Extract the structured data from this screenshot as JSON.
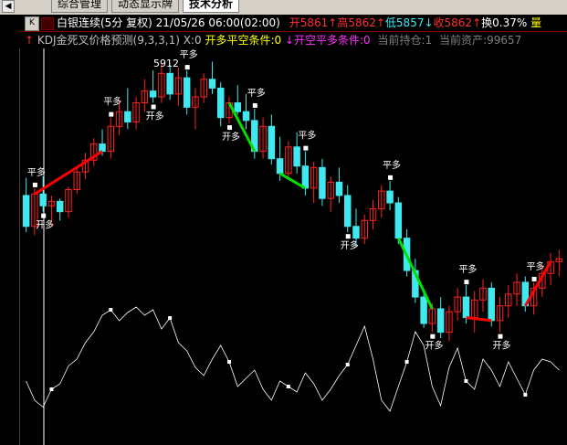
{
  "tabs": [
    {
      "label": "综合管理",
      "active": false
    },
    {
      "label": "动态显示牌",
      "active": false
    },
    {
      "label": "技术分析",
      "active": true
    }
  ],
  "header": {
    "k_button": "K",
    "title": "白银连续(5分 复权) 21/05/26 06:00(02:00)",
    "open": "开5861",
    "high": "高5862",
    "low": "低5857",
    "close": "收5862",
    "turnover": "换0.37%",
    "extra": "量"
  },
  "formula": {
    "name": "KDJ金死叉价格预测(9,3,3,1) X:0",
    "buy_cond": "开多平空条件:0",
    "sell_cond": "开空平多条件:0",
    "position": "当前持仓:1",
    "assets": "当前资产:99657"
  },
  "annotations": {
    "price_label": "5912",
    "buy_tag": "开多",
    "sell_tag": "平多"
  },
  "colors": {
    "up": "#ff2020",
    "down": "#40e8f0",
    "buy_signal": "#00e000",
    "sell_signal": "#ff0000",
    "kdj_line": "#ffffff",
    "bg": "#000000"
  },
  "candles": [
    [
      5905,
      5917,
      5880,
      5884
    ],
    [
      5884,
      5910,
      5878,
      5906
    ],
    [
      5906,
      5918,
      5894,
      5898
    ],
    [
      5898,
      5905,
      5884,
      5901
    ],
    [
      5901,
      5903,
      5888,
      5894
    ],
    [
      5894,
      5911,
      5890,
      5909
    ],
    [
      5909,
      5925,
      5906,
      5921
    ],
    [
      5921,
      5934,
      5916,
      5929
    ],
    [
      5929,
      5944,
      5925,
      5940
    ],
    [
      5940,
      5950,
      5932,
      5935
    ],
    [
      5935,
      5958,
      5930,
      5952
    ],
    [
      5952,
      5970,
      5946,
      5962
    ],
    [
      5962,
      5978,
      5950,
      5955
    ],
    [
      5955,
      5972,
      5950,
      5968
    ],
    [
      5968,
      5984,
      5962,
      5976
    ],
    [
      5976,
      5990,
      5968,
      5972
    ],
    [
      5972,
      5995,
      5968,
      5988
    ],
    [
      5988,
      5994,
      5970,
      5974
    ],
    [
      5974,
      5992,
      5966,
      5985
    ],
    [
      5985,
      5990,
      5960,
      5965
    ],
    [
      5965,
      5978,
      5950,
      5972
    ],
    [
      5972,
      5988,
      5968,
      5984
    ],
    [
      5984,
      5996,
      5974,
      5978
    ],
    [
      5978,
      5982,
      5952,
      5958
    ],
    [
      5958,
      5972,
      5954,
      5968
    ],
    [
      5968,
      5980,
      5960,
      5962
    ],
    [
      5962,
      5974,
      5950,
      5956
    ],
    [
      5956,
      5964,
      5930,
      5935
    ],
    [
      5935,
      5958,
      5930,
      5952
    ],
    [
      5952,
      5960,
      5926,
      5930
    ],
    [
      5930,
      5945,
      5915,
      5920
    ],
    [
      5920,
      5942,
      5916,
      5938
    ],
    [
      5938,
      5948,
      5920,
      5925
    ],
    [
      5925,
      5935,
      5905,
      5910
    ],
    [
      5910,
      5928,
      5900,
      5924
    ],
    [
      5924,
      5930,
      5898,
      5903
    ],
    [
      5903,
      5918,
      5894,
      5914
    ],
    [
      5914,
      5924,
      5900,
      5905
    ],
    [
      5905,
      5912,
      5880,
      5884
    ],
    [
      5884,
      5896,
      5870,
      5876
    ],
    [
      5876,
      5892,
      5872,
      5888
    ],
    [
      5888,
      5902,
      5882,
      5896
    ],
    [
      5896,
      5912,
      5890,
      5908
    ],
    [
      5908,
      5915,
      5895,
      5900
    ],
    [
      5900,
      5904,
      5872,
      5876
    ],
    [
      5876,
      5882,
      5850,
      5854
    ],
    [
      5854,
      5862,
      5832,
      5836
    ],
    [
      5836,
      5840,
      5815,
      5818
    ],
    [
      5818,
      5832,
      5812,
      5828
    ],
    [
      5828,
      5836,
      5808,
      5812
    ],
    [
      5812,
      5830,
      5806,
      5826
    ],
    [
      5826,
      5842,
      5820,
      5836
    ],
    [
      5836,
      5844,
      5818,
      5822
    ],
    [
      5822,
      5840,
      5812,
      5834
    ],
    [
      5834,
      5848,
      5826,
      5842
    ],
    [
      5842,
      5846,
      5816,
      5820
    ],
    [
      5820,
      5836,
      5812,
      5830
    ],
    [
      5830,
      5844,
      5822,
      5838
    ],
    [
      5838,
      5852,
      5830,
      5846
    ],
    [
      5846,
      5850,
      5826,
      5830
    ],
    [
      5830,
      5846,
      5824,
      5842
    ],
    [
      5842,
      5858,
      5836,
      5852
    ],
    [
      5852,
      5866,
      5844,
      5860
    ],
    [
      5860,
      5868,
      5850,
      5862
    ]
  ],
  "kdj": [
    44,
    30,
    25,
    38,
    42,
    55,
    60,
    72,
    80,
    92,
    96,
    88,
    94,
    98,
    92,
    96,
    82,
    90,
    72,
    66,
    54,
    48,
    60,
    70,
    58,
    40,
    46,
    52,
    38,
    30,
    44,
    40,
    36,
    50,
    42,
    30,
    38,
    48,
    56,
    70,
    84,
    60,
    30,
    22,
    40,
    58,
    80,
    70,
    40,
    26,
    54,
    68,
    44,
    38,
    60,
    52,
    40,
    58,
    46,
    34,
    52,
    60,
    58,
    52
  ]
}
